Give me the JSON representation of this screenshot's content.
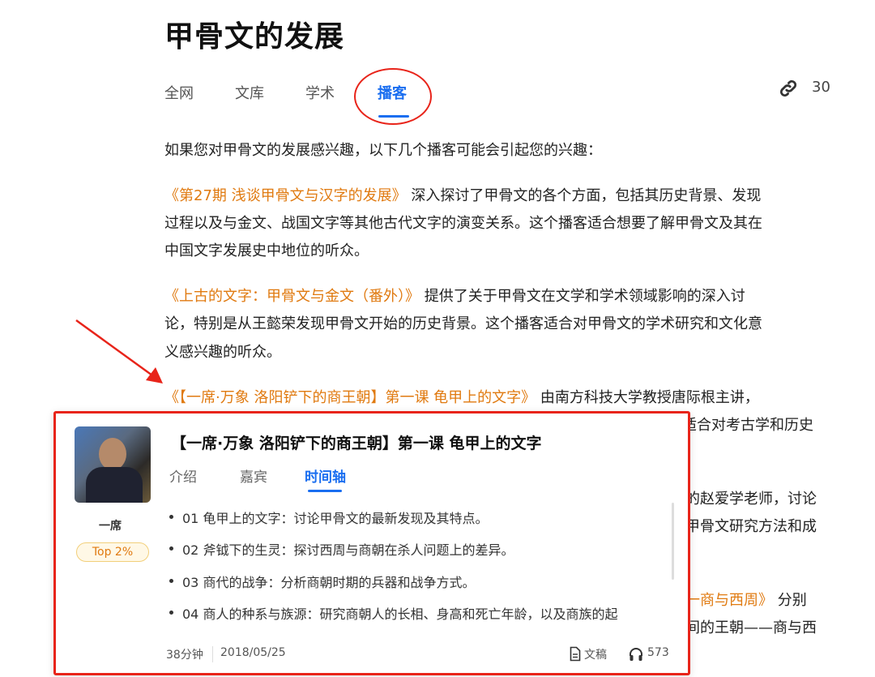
{
  "page_title": "甲骨文的发展",
  "tabs": [
    {
      "label": "全网",
      "active": false
    },
    {
      "label": "文库",
      "active": false
    },
    {
      "label": "学术",
      "active": false
    },
    {
      "label": "播客",
      "active": true
    }
  ],
  "link_count": "30",
  "intro": "如果您对甲骨文的发展感兴趣，以下几个播客可能会引起您的兴趣：",
  "paragraphs": [
    {
      "link": "《第27期 浅谈甲骨文与汉字的发展》",
      "lines": [
        "深入探讨了甲骨文的各个方面，包括其历史背景、发现",
        "过程以及与金文、战国文字等其他古代文字的演变关系。这个播客适合想要了解甲骨文及其在",
        "中国文字发展史中地位的听众。"
      ]
    },
    {
      "link": "《上古的文字：甲骨文与金文（番外）》",
      "lines": [
        "提供了关于甲骨文在文学和学术领域影响的深入讨",
        "论，特别是从王懿荣发现甲骨文开始的历史背景。这个播客适合对甲骨文的学术研究和文化意",
        "义感兴趣的听众。"
      ]
    },
    {
      "link": "《【一席·万象 洛阳铲下的商王朝】第一课 龟甲上的文字》",
      "lines": [
        "由南方科技大学教授唐际根主讲，",
        "适合对考古学和历史"
      ]
    },
    {
      "lines": [
        "的赵爱学老师，讨论",
        "甲骨文研究方法和成"
      ]
    },
    {
      "link": "一商与西周》",
      "lines": [
        "分别",
        "间的王朝——商与西"
      ]
    }
  ],
  "popup": {
    "title": "【一席·万象 洛阳铲下的商王朝】第一课 龟甲上的文字",
    "host": "一席",
    "badge": "Top 2%",
    "tabs": [
      {
        "label": "介绍",
        "active": false
      },
      {
        "label": "嘉宾",
        "active": false
      },
      {
        "label": "时间轴",
        "active": true
      }
    ],
    "timeline": [
      "01 龟甲上的文字：讨论甲骨文的最新发现及其特点。",
      "02 斧钺下的生灵：探讨西周与商朝在杀人问题上的差异。",
      "03 商代的战争：分析商朝时期的兵器和战争方式。",
      "04 商人的种系与族源：研究商朝人的长相、身高和死亡年龄，以及商族的起"
    ],
    "duration": "38分钟",
    "date": "2018/05/25",
    "transcript_label": "文稿",
    "plays": "573"
  },
  "colors": {
    "accent": "#1a6ef0",
    "link": "#e07a10",
    "annotation": "#e8241a"
  }
}
